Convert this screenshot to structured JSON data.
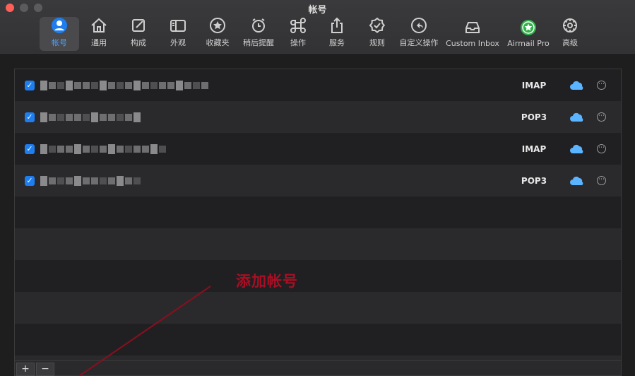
{
  "window": {
    "title": "帐号"
  },
  "toolbar": {
    "items": [
      {
        "label": "帐号",
        "icon": "account-icon",
        "selected": true
      },
      {
        "label": "通用",
        "icon": "home-icon"
      },
      {
        "label": "构成",
        "icon": "compose-icon"
      },
      {
        "label": "外观",
        "icon": "sidebar-icon"
      },
      {
        "label": "收藏夹",
        "icon": "star-icon"
      },
      {
        "label": "稍后提醒",
        "icon": "alarm-icon"
      },
      {
        "label": "操作",
        "icon": "command-icon"
      },
      {
        "label": "服务",
        "icon": "share-icon"
      },
      {
        "label": "规则",
        "icon": "badge-check-icon"
      },
      {
        "label": "自定义操作",
        "icon": "undo-circle-icon"
      },
      {
        "label": "Custom Inbox",
        "icon": "inbox-icon"
      },
      {
        "label": "Airmail Pro",
        "icon": "star-badge-icon"
      },
      {
        "label": "高级",
        "icon": "gear-icon"
      }
    ]
  },
  "accounts": [
    {
      "checked": true,
      "protocol": "IMAP"
    },
    {
      "checked": true,
      "protocol": "POP3"
    },
    {
      "checked": true,
      "protocol": "IMAP"
    },
    {
      "checked": true,
      "protocol": "POP3"
    }
  ],
  "bottom": {
    "add_label": "+",
    "remove_label": "−"
  },
  "annotation": {
    "text": "添加帐号",
    "color": "#a80f24"
  },
  "colors": {
    "accent": "#1e7ef0",
    "cloud": "#5ab4ff",
    "pro_green": "#2fb24a"
  }
}
